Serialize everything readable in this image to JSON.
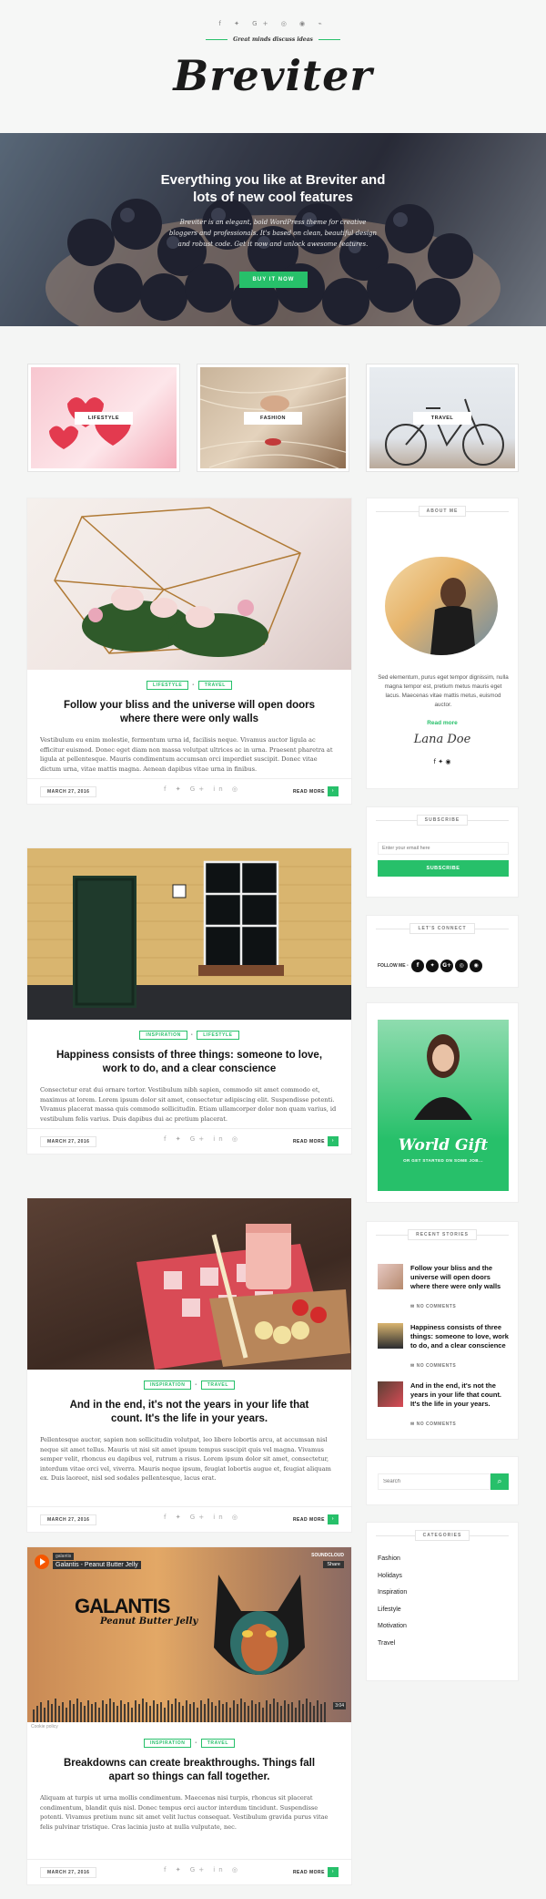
{
  "header": {
    "social": "f ✦ G+ ◎ ◉ ⌁",
    "tagline": "Great minds discuss ideas",
    "logo": "Breviter"
  },
  "hero": {
    "title_line1": "Everything you like at Breviter and",
    "title_line2": "lots of new cool features",
    "text": "Breviter is an elegant, bold WordPress theme for creative bloggers and professionals. It's based on clean, beautiful design and robust code. Get it now and unlock awesome features.",
    "button": "BUY IT NOW"
  },
  "categories": [
    {
      "label": "LIFESTYLE"
    },
    {
      "label": "FASHION"
    },
    {
      "label": "TRAVEL"
    }
  ],
  "posts": [
    {
      "tags": [
        "LIFESTYLE",
        "TRAVEL"
      ],
      "title": "Follow your bliss and the universe will open doors where there were only walls",
      "excerpt": "Vestibulum eu enim molestie, fermentum urna id, facilisis neque. Vivamus auctor ligula ac efficitur euismod. Donec eget diam non massa volutpat ultrices ac in urna. Praesent pharetra at ligula at pellentesque. Mauris condimentum accumsan orci imperdiet suscipit. Donec vitae dictum urna, vitae mattis magna. Aenean dapibus vitae urna in finibus.",
      "date": "MARCH 27, 2016",
      "more": "READ MORE"
    },
    {
      "tags": [
        "INSPIRATION",
        "LIFESTYLE"
      ],
      "title": "Happiness consists of three things: someone to love, work to do, and a clear conscience",
      "excerpt": "Consectetur erat dui ornare tortor. Vestibulum nibh sapien, commodo sit amet commodo et, maximus at lorem. Lorem ipsum dolor sit amet, consectetur adipiscing elit. Suspendisse potenti. Vivamus placerat massa quis commodo sollicitudin. Etiam ullamcorper dolor non quam varius, id vestibulum felis varius. Duis dapibus dui ac pretium placerat.",
      "date": "MARCH 27, 2016",
      "more": "READ MORE"
    },
    {
      "tags": [
        "INSPIRATION",
        "TRAVEL"
      ],
      "title": "And in the end, it's not the years in your life that count. It's the life in your years.",
      "excerpt": "Pellentesque auctor, sapien non sollicitudin volutpat, leo libero lobortis arcu, at accumsan nisl neque sit amet tellus. Mauris ut nisi sit amet ipsum tempus suscipit quis vel magna. Vivamus semper velit, rhoncus eu dapibus vel, rutrum a risus. Lorem ipsum dolor sit amet, consectetur, interdum vitae orci vel, viverra. Mauris neque ipsum, feugiat lobortis augue et, feugiat aliquam ex. Duis laoreet, nisl sed sodales pellentesque, lacus erat.",
      "date": "MARCH 27, 2016",
      "more": "READ MORE"
    },
    {
      "tags": [
        "INSPIRATION",
        "TRAVEL"
      ],
      "title": "Breakdowns can create breakthroughs. Things fall apart so things can fall together.",
      "excerpt": "Aliquam at turpis ut urna mollis condimentum. Maecenas nisi turpis, rhoncus sit placerat condimentum, blandit quis nisl. Donec tempus orci auctor interdum tincidunt. Suspendisse potenti. Vivamus pretium nunc sit amet velit luctus consequat. Vestibulum gravida purus vitae felis pulvinar tristique. Cras lacinia justo at nulla vulputate, nec.",
      "date": "MARCH 27, 2016",
      "more": "READ MORE",
      "player": {
        "user": "galantis",
        "track": "Galantis - Peanut Butter Jelly",
        "brand": "SOUNDCLOUD",
        "share": "Share",
        "art_title": "GALANTIS",
        "art_sub": "Peanut Butter Jelly",
        "time": "3:04",
        "cookie": "Cookie policy"
      }
    }
  ],
  "sidebar": {
    "about": {
      "title": "ABOUT ME",
      "text": "Sed elementum, purus eget tempor dignissim, nulla magna tempor est, pretium metus mauris eget lacus. Maecenas vitae mattis metus, euismod auctor.",
      "more": "Read more",
      "signature": "Lana Doe",
      "social": "f  ✦  ◉"
    },
    "subscribe": {
      "title": "SUBSCRIBE",
      "placeholder": "Enter your email here",
      "button": "SUBSCRIBE"
    },
    "connect": {
      "title": "LET'S CONNECT",
      "label": "FOLLOW ME",
      "icons": [
        "f",
        "✦",
        "G+",
        "◎",
        "◉"
      ]
    },
    "ad": {
      "title": "World Gift",
      "sub": "OR GET STARTED ON SOME JOB..."
    },
    "recent": {
      "title": "RECENT STORIES",
      "items": [
        {
          "title": "Follow your bliss and the universe will open doors where there were only walls",
          "comments": "NO COMMENTS"
        },
        {
          "title": "Happiness consists of three things: someone to love, work to do, and a clear conscience",
          "comments": "NO COMMENTS"
        },
        {
          "title": "And in the end, it's not the years in your life that count. It's the life in your years.",
          "comments": "NO COMMENTS"
        }
      ]
    },
    "search": {
      "placeholder": "Search"
    },
    "categories": {
      "title": "CATEGORIES",
      "items": [
        "Fashion",
        "Holidays",
        "Inspiration",
        "Lifestyle",
        "Motivation",
        "Travel"
      ]
    }
  },
  "colors": {
    "accent": "#27c06a"
  }
}
